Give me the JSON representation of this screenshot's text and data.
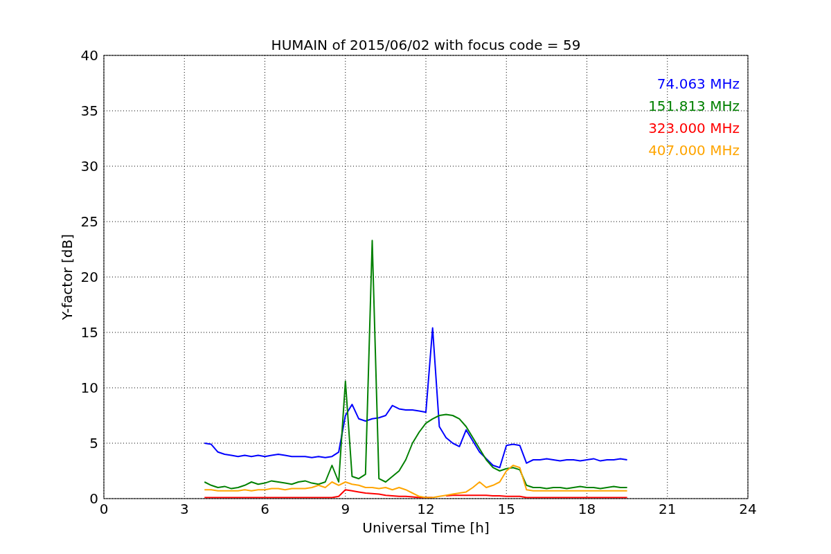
{
  "chart_data": {
    "type": "line",
    "title": "HUMAIN of 2015/06/02 with focus code = 59",
    "xlabel": "Universal Time [h]",
    "ylabel": "Y-factor [dB]",
    "xlim": [
      0,
      24
    ],
    "ylim": [
      0,
      40
    ],
    "xticks": [
      0,
      3,
      6,
      9,
      12,
      15,
      18,
      21,
      24
    ],
    "yticks": [
      0,
      5,
      10,
      15,
      20,
      25,
      30,
      35,
      40
    ],
    "grid": true,
    "x": [
      3.75,
      4,
      4.25,
      4.5,
      4.75,
      5,
      5.25,
      5.5,
      5.75,
      6,
      6.25,
      6.5,
      6.75,
      7,
      7.25,
      7.5,
      7.75,
      8,
      8.25,
      8.5,
      8.75,
      9,
      9.25,
      9.5,
      9.75,
      10,
      10.25,
      10.5,
      10.75,
      11,
      11.25,
      11.5,
      11.75,
      12,
      12.25,
      12.5,
      12.75,
      13,
      13.25,
      13.5,
      13.75,
      14,
      14.25,
      14.5,
      14.75,
      15,
      15.25,
      15.5,
      15.75,
      16,
      16.25,
      16.5,
      16.75,
      17,
      17.25,
      17.5,
      17.75,
      18,
      18.25,
      18.5,
      18.75,
      19,
      19.25,
      19.5
    ],
    "series": [
      {
        "name": "74.063 MHz",
        "color": "#0000ff",
        "values": [
          5.0,
          4.9,
          4.2,
          4.0,
          3.9,
          3.8,
          3.9,
          3.8,
          3.9,
          3.8,
          3.9,
          4.0,
          3.9,
          3.8,
          3.8,
          3.8,
          3.7,
          3.8,
          3.7,
          3.8,
          4.2,
          7.5,
          8.5,
          7.2,
          7.0,
          7.2,
          7.3,
          7.5,
          8.4,
          8.1,
          8.0,
          8.0,
          7.9,
          7.8,
          15.4,
          6.5,
          5.5,
          5.0,
          4.7,
          6.2,
          5.2,
          4.2,
          3.6,
          3.0,
          2.8,
          4.8,
          4.9,
          4.8,
          3.2,
          3.5,
          3.5,
          3.6,
          3.5,
          3.4,
          3.5,
          3.5,
          3.4,
          3.5,
          3.6,
          3.4,
          3.5,
          3.5,
          3.6,
          3.5
        ]
      },
      {
        "name": "151.813 MHz",
        "color": "#008000",
        "values": [
          1.5,
          1.2,
          1.0,
          1.1,
          0.9,
          1.0,
          1.2,
          1.5,
          1.3,
          1.4,
          1.6,
          1.5,
          1.4,
          1.3,
          1.5,
          1.6,
          1.4,
          1.3,
          1.5,
          3.0,
          1.5,
          10.6,
          2.0,
          1.8,
          2.2,
          23.3,
          1.8,
          1.5,
          2.0,
          2.5,
          3.5,
          5.0,
          6.0,
          6.8,
          7.2,
          7.5,
          7.6,
          7.5,
          7.2,
          6.5,
          5.5,
          4.5,
          3.5,
          2.8,
          2.5,
          2.7,
          2.8,
          2.6,
          1.2,
          1.0,
          1.0,
          0.9,
          1.0,
          1.0,
          0.9,
          1.0,
          1.1,
          1.0,
          1.0,
          0.9,
          1.0,
          1.1,
          1.0,
          1.0
        ]
      },
      {
        "name": "323.000 MHz",
        "color": "#ff0000",
        "values": [
          0.1,
          0.1,
          0.1,
          0.1,
          0.1,
          0.1,
          0.1,
          0.1,
          0.1,
          0.1,
          0.1,
          0.1,
          0.1,
          0.1,
          0.1,
          0.1,
          0.1,
          0.1,
          0.1,
          0.1,
          0.2,
          0.8,
          0.7,
          0.6,
          0.5,
          0.45,
          0.4,
          0.3,
          0.25,
          0.2,
          0.2,
          0.15,
          0.1,
          0.1,
          0.1,
          null,
          0.25,
          0.3,
          0.3,
          0.3,
          0.3,
          0.3,
          0.3,
          0.25,
          0.25,
          0.2,
          0.2,
          0.2,
          0.1,
          0.1,
          0.1,
          0.1,
          0.1,
          0.1,
          0.1,
          0.1,
          0.1,
          0.1,
          0.1,
          0.1,
          0.1,
          0.1,
          0.1,
          0.1
        ]
      },
      {
        "name": "407.000 MHz",
        "color": "#ffa500",
        "values": [
          0.8,
          0.8,
          0.7,
          0.7,
          0.7,
          0.7,
          0.8,
          0.7,
          0.8,
          0.8,
          0.9,
          0.9,
          0.8,
          0.9,
          0.9,
          0.9,
          1.0,
          1.2,
          1.0,
          1.5,
          1.2,
          1.5,
          1.3,
          1.2,
          1.0,
          1.0,
          0.9,
          1.0,
          0.8,
          1.0,
          0.8,
          0.5,
          0.2,
          0.1,
          0.1,
          0.2,
          0.3,
          0.4,
          0.5,
          0.6,
          1.0,
          1.5,
          1.0,
          1.2,
          1.5,
          2.5,
          3.0,
          2.8,
          0.8,
          0.7,
          0.7,
          0.7,
          0.7,
          0.7,
          0.7,
          0.7,
          0.7,
          0.7,
          0.7,
          0.7,
          0.7,
          0.7,
          0.7,
          0.7
        ]
      }
    ]
  }
}
